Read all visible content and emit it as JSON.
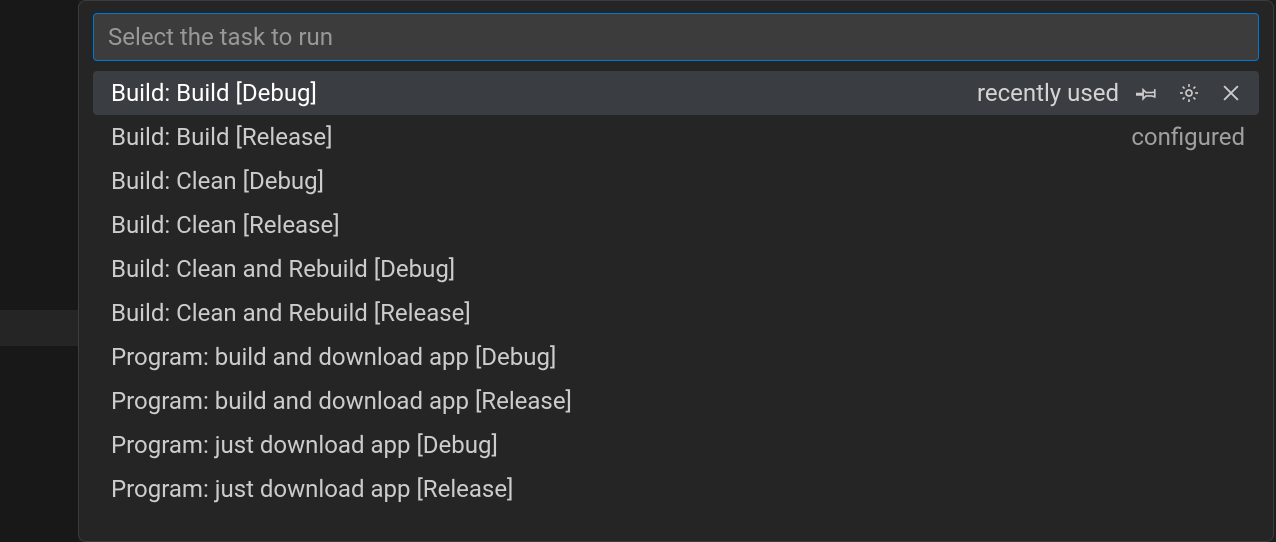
{
  "search": {
    "placeholder": "Select the task to run",
    "value": ""
  },
  "tasks": [
    {
      "label": "Build: Build [Debug]",
      "badge": "recently used",
      "selected": true,
      "showActions": true
    },
    {
      "label": "Build: Build [Release]",
      "badge": "configured",
      "selected": false,
      "showActions": false
    },
    {
      "label": "Build: Clean [Debug]",
      "badge": "",
      "selected": false,
      "showActions": false
    },
    {
      "label": "Build: Clean [Release]",
      "badge": "",
      "selected": false,
      "showActions": false
    },
    {
      "label": "Build: Clean and Rebuild [Debug]",
      "badge": "",
      "selected": false,
      "showActions": false
    },
    {
      "label": "Build: Clean and Rebuild [Release]",
      "badge": "",
      "selected": false,
      "showActions": false
    },
    {
      "label": "Program: build and download app [Debug]",
      "badge": "",
      "selected": false,
      "showActions": false
    },
    {
      "label": "Program: build and download app [Release]",
      "badge": "",
      "selected": false,
      "showActions": false
    },
    {
      "label": "Program: just download app [Debug]",
      "badge": "",
      "selected": false,
      "showActions": false
    },
    {
      "label": "Program: just download app [Release]",
      "badge": "",
      "selected": false,
      "showActions": false
    }
  ],
  "icons": {
    "pin": "pin-icon",
    "gear": "gear-icon",
    "close": "close-icon"
  }
}
